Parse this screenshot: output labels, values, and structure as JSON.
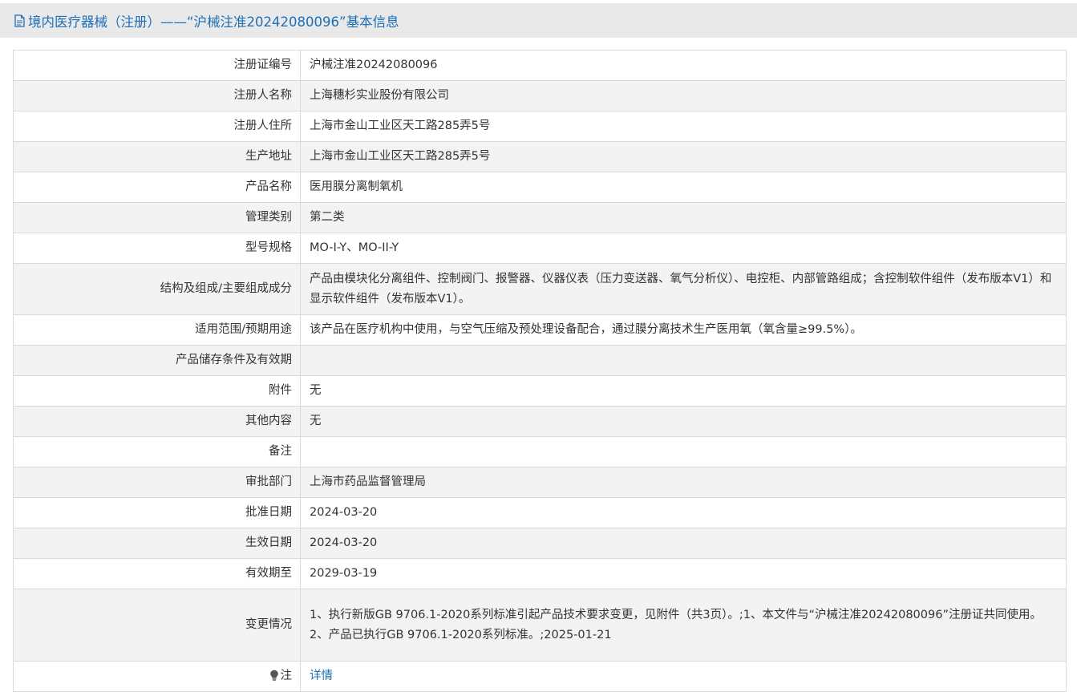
{
  "header": {
    "title": "境内医疗器械（注册）——“沪械注准20242080096”基本信息",
    "icon": "document-icon"
  },
  "rows": [
    {
      "label": "注册证编号",
      "value": "沪械注准20242080096"
    },
    {
      "label": "注册人名称",
      "value": "上海穗杉实业股份有限公司"
    },
    {
      "label": "注册人住所",
      "value": "上海市金山工业区天工路285弄5号"
    },
    {
      "label": "生产地址",
      "value": "上海市金山工业区天工路285弄5号"
    },
    {
      "label": "产品名称",
      "value": "医用膜分离制氧机"
    },
    {
      "label": "管理类别",
      "value": "第二类"
    },
    {
      "label": "型号规格",
      "value": "MO-I-Y、MO-II-Y"
    },
    {
      "label": "结构及组成/主要组成成分",
      "value": "产品由模块化分离组件、控制阀门、报警器、仪器仪表（压力变送器、氧气分析仪）、电控柜、内部管路组成；含控制软件组件（发布版本V1）和显示软件组件（发布版本V1）。"
    },
    {
      "label": "适用范围/预期用途",
      "value": "该产品在医疗机构中使用，与空气压缩及预处理设备配合，通过膜分离技术生产医用氧（氧含量≥99.5%）。"
    },
    {
      "label": "产品储存条件及有效期",
      "value": ""
    },
    {
      "label": "附件",
      "value": "无"
    },
    {
      "label": "其他内容",
      "value": "无"
    },
    {
      "label": "备注",
      "value": ""
    },
    {
      "label": "审批部门",
      "value": "上海市药品监督管理局"
    },
    {
      "label": "批准日期",
      "value": "2024-03-20"
    },
    {
      "label": "生效日期",
      "value": "2024-03-20"
    },
    {
      "label": "有效期至",
      "value": "2029-03-19"
    },
    {
      "label": "变更情况",
      "value_lines": [
        "1、执行新版GB 9706.1-2020系列标准引起产品技术要求变更，见附件（共3页）。;1、本文件与“沪械注准20242080096”注册证共同使用。",
        "2、产品已执行GB 9706.1-2020系列标准。;2025-01-21"
      ]
    },
    {
      "label": "注",
      "value": "详情",
      "icon": "lightbulb-icon"
    }
  ],
  "colors": {
    "link": "#1d6fb8",
    "header_bg": "#e9e9e9",
    "row_alt_bg": "#f3f3f3",
    "border": "#d9d9d9"
  }
}
